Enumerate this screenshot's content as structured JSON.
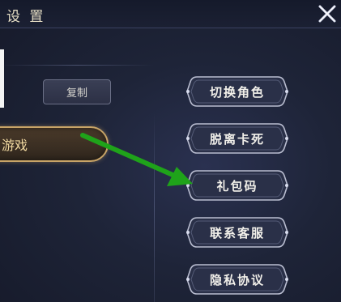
{
  "window": {
    "title": "设 置"
  },
  "left_panel": {
    "copy_button_label": "复制",
    "game_button_label": "游戏"
  },
  "menu": {
    "items": [
      {
        "label": "切换角色"
      },
      {
        "label": "脱离卡死"
      },
      {
        "label": "礼包码"
      },
      {
        "label": "联系客服"
      },
      {
        "label": "隐私协议"
      }
    ]
  },
  "colors": {
    "arrow": "#1fa31a",
    "title_text": "#e9e1c7",
    "gold_border": "#c8a467"
  },
  "icons": {
    "close": "close-icon",
    "arrow": "green-arrow-annotation"
  }
}
